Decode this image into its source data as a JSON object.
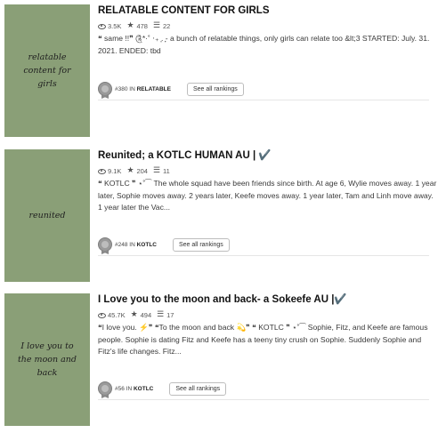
{
  "stories": [
    {
      "cover_text": "relatable content for girls",
      "title": "RELATABLE CONTENT FOR GIRLS",
      "reads": "3.5K",
      "votes": "478",
      "parts": "22",
      "description": "❝ same !!❞ ༊*·˚ ‧₊ ͙. ̟- a bunch of relatable things, only girls can relate too &lt;3 STARTED: July. 31. 2021. ENDED: tbd",
      "rank_prefix": "#380 IN",
      "rank_tag": "RELATABLE",
      "see_all": "See all rankings"
    },
    {
      "cover_text": "reunited",
      "title": "Reunited; a KOTLC HUMAN AU | ✔️",
      "reads": "9.1K",
      "votes": "204",
      "parts": "11",
      "description": "❝ KOTLC ❞ ⋆˚⁀ The whole squad have been friends since birth. At age 6, Wylie moves away. 1 year later, Sophie moves away. 2 years later, Keefe moves away. 1 year later, Tam and Linh move away. 1 year later the Vac...",
      "rank_prefix": "#248 IN",
      "rank_tag": "KOTLC",
      "see_all": "See all rankings"
    },
    {
      "cover_text": "I love you to the moon and back",
      "title": "I Love you to the moon and back- a Sokeefe AU |✔️",
      "reads": "45.7K",
      "votes": "494",
      "parts": "17",
      "description": "❝I love you. ⚡❞ ❝To the moon and back 💫❞ ❝ KOTLC ❞ ⋆˚⁀ Sophie, Fitz, and Keefe are famous people. Sophie is dating Fitz and Keefe has a teeny tiny crush on Sophie. Suddenly Sophie and Fitz's life changes. Fitz...",
      "rank_prefix": "#56 IN",
      "rank_tag": "KOTLC",
      "see_all": "See all rankings"
    }
  ]
}
